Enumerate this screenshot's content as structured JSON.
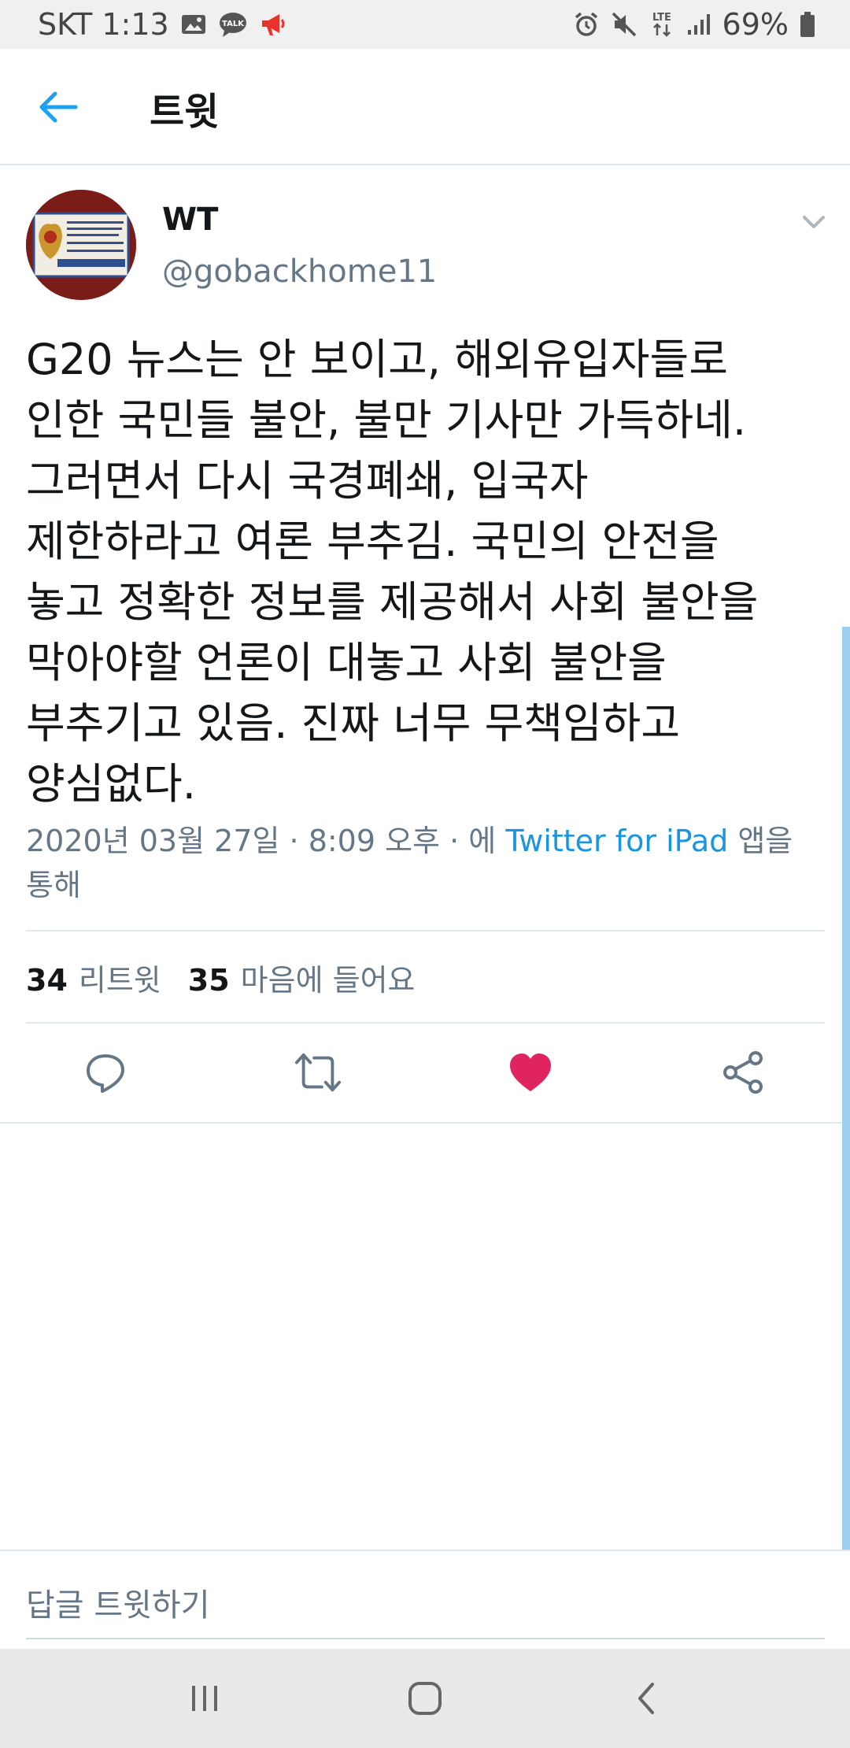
{
  "status_bar": {
    "carrier_time": "SKT 1:13",
    "battery": "69%",
    "icons": [
      "gallery-icon",
      "talk-icon",
      "megaphone-icon",
      "alarm-icon",
      "mute-icon",
      "lte-icon",
      "signal-icon",
      "battery-icon"
    ]
  },
  "app_bar": {
    "title": "트윗",
    "back_icon": "arrow-left-icon"
  },
  "tweet": {
    "author_name": "WT",
    "author_handle": "@gobackhome11",
    "text_lines": [
      "G20 뉴스는 안 보이고, 해외유입자들로",
      "인한 국민들 불안, 불만 기사만 가득하네.",
      "그러면서 다시 국경폐쇄, 입국자",
      "제한하라고 여론 부추김. 국민의 안전을",
      "놓고 정확한 정보를 제공해서 사회 불안을",
      "막아야할 언론이 대놓고 사회 불안을",
      "부추기고 있음. 진짜 너무 무책임하고",
      "양심없다."
    ],
    "meta_prefix": "2020년 03월 27일 · 8:09 오후 · 에 ",
    "source": "Twitter for iPad",
    "meta_suffix_1": " 앱을",
    "meta_suffix_2": "통해",
    "retweet_count": "34",
    "retweet_label": "리트윗",
    "like_count": "35",
    "like_label": "마음에 들어요"
  },
  "actions": {
    "icons": [
      "reply-icon",
      "retweet-icon",
      "like-icon",
      "share-icon"
    ],
    "like_color": "#e0245e",
    "icon_color": "#657786"
  },
  "reply_bar": {
    "placeholder": "답글 트윗하기"
  },
  "colors": {
    "accent": "#1da1f2",
    "link": "#1b95e0",
    "secondary_text": "#657786"
  }
}
